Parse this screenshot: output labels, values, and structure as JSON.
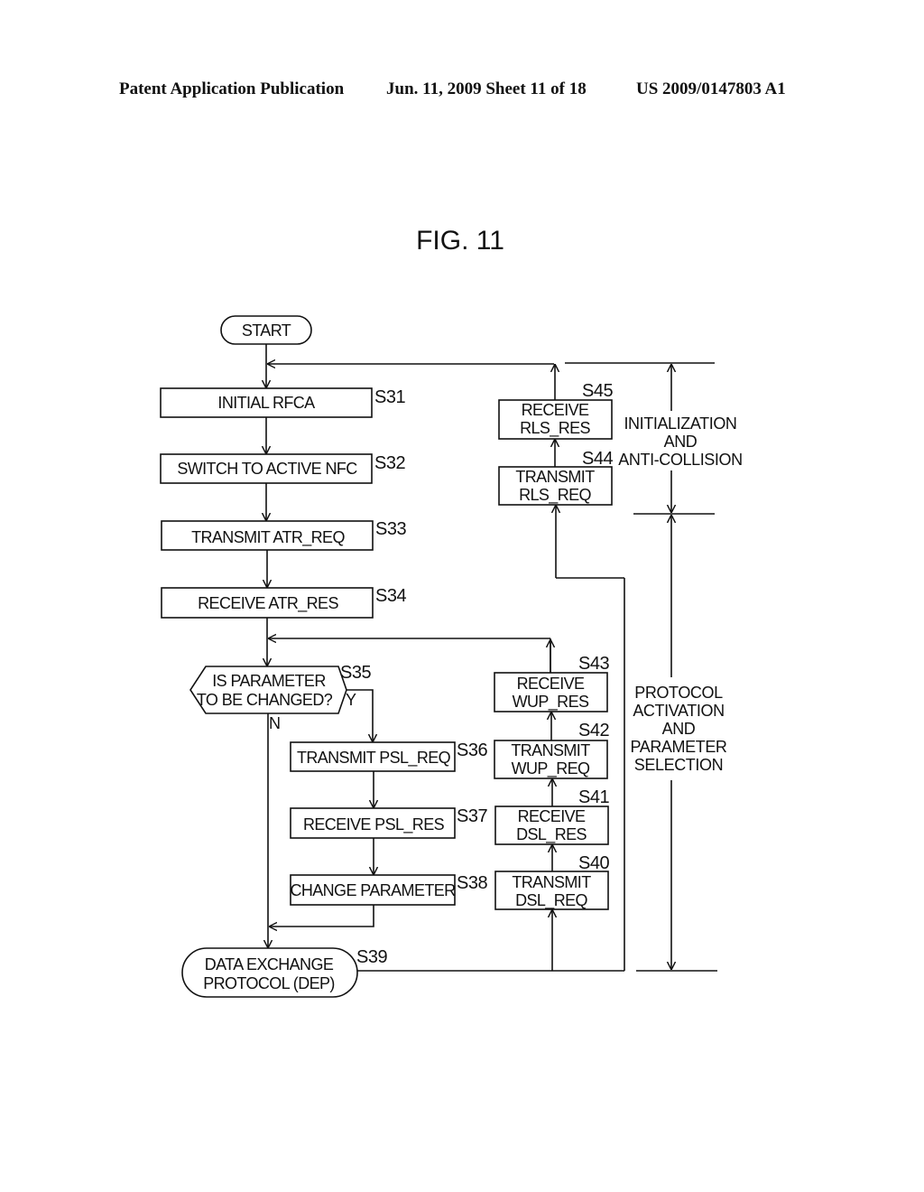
{
  "header": {
    "left": "Patent Application Publication",
    "middle": "Jun. 11, 2009  Sheet 11 of 18",
    "right": "US 2009/0147803 A1"
  },
  "figure": {
    "title": "FIG. 11"
  },
  "flow": {
    "start": "START",
    "s31": {
      "step": "S31",
      "label": "INITIAL RFCA"
    },
    "s32": {
      "step": "S32",
      "label": "SWITCH TO ACTIVE NFC"
    },
    "s33": {
      "step": "S33",
      "label": "TRANSMIT ATR_REQ"
    },
    "s34": {
      "step": "S34",
      "label": "RECEIVE ATR_RES"
    },
    "s35": {
      "step": "S35",
      "line1": "IS PARAMETER",
      "line2": "TO BE CHANGED?",
      "yes": "Y",
      "no": "N"
    },
    "s36": {
      "step": "S36",
      "label": "TRANSMIT PSL_REQ"
    },
    "s37": {
      "step": "S37",
      "label": "RECEIVE PSL_RES"
    },
    "s38": {
      "step": "S38",
      "label": "CHANGE PARAMETER"
    },
    "s39": {
      "step": "S39",
      "line1": "DATA EXCHANGE",
      "line2": "PROTOCOL (DEP)"
    },
    "s40": {
      "step": "S40",
      "line1": "TRANSMIT",
      "line2": "DSL_REQ"
    },
    "s41": {
      "step": "S41",
      "line1": "RECEIVE",
      "line2": "DSL_RES"
    },
    "s42": {
      "step": "S42",
      "line1": "TRANSMIT",
      "line2": "WUP_REQ"
    },
    "s43": {
      "step": "S43",
      "line1": "RECEIVE",
      "line2": "WUP_RES"
    },
    "s44": {
      "step": "S44",
      "line1": "TRANSMIT",
      "line2": "RLS_REQ"
    },
    "s45": {
      "step": "S45",
      "line1": "RECEIVE",
      "line2": "RLS_RES"
    }
  },
  "phases": {
    "init": [
      "INITIALIZATION",
      "AND",
      "ANTI-COLLISION"
    ],
    "protocol": [
      "PROTOCOL",
      "ACTIVATION",
      "AND",
      "PARAMETER",
      "SELECTION"
    ]
  }
}
